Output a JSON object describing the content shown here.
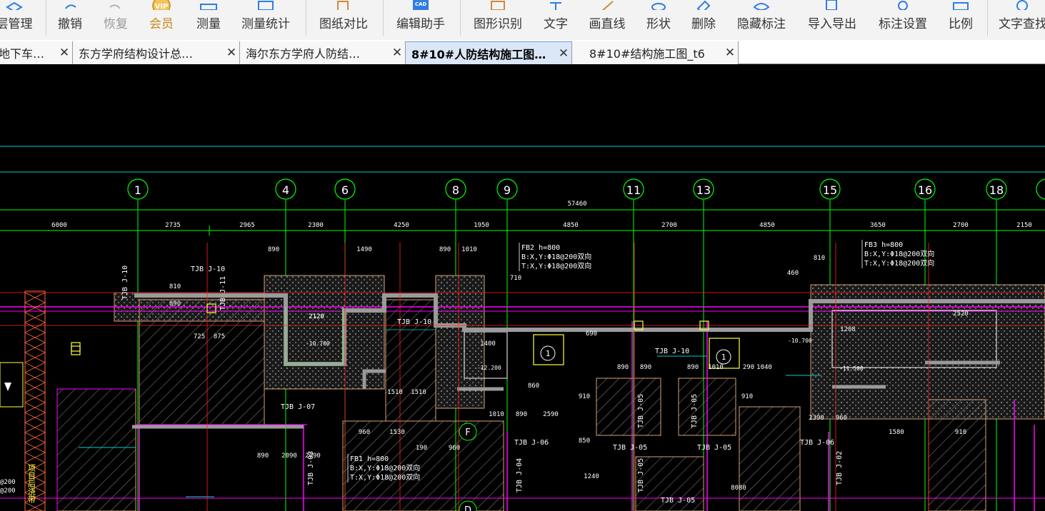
{
  "toolbar": {
    "items": [
      {
        "label": "层管理",
        "icon": "layers-icon"
      },
      {
        "label": "撤销",
        "icon": "undo-icon"
      },
      {
        "label": "恢复",
        "icon": "redo-icon",
        "disabled": true
      },
      {
        "label": "会员",
        "icon": "vip-icon",
        "badge": "VIP"
      },
      {
        "label": "测量",
        "icon": "ruler-icon"
      },
      {
        "label": "测量统计",
        "icon": "measure-stats-icon"
      },
      {
        "label": "图纸对比",
        "icon": "compare-icon"
      },
      {
        "label": "编辑助手",
        "icon": "cad-edit-icon",
        "badge": "CAD"
      },
      {
        "label": "图形识别",
        "icon": "shape-recognize-icon"
      },
      {
        "label": "文字",
        "icon": "text-icon"
      },
      {
        "label": "画直线",
        "icon": "line-icon"
      },
      {
        "label": "形状",
        "icon": "shape-icon"
      },
      {
        "label": "删除",
        "icon": "eraser-icon"
      },
      {
        "label": "隐藏标注",
        "icon": "eye-icon"
      },
      {
        "label": "导入导出",
        "icon": "import-export-icon"
      },
      {
        "label": "标注设置",
        "icon": "settings-icon"
      },
      {
        "label": "比例",
        "icon": "scale-icon"
      },
      {
        "label": "文字查找",
        "icon": "text-search-icon"
      }
    ]
  },
  "tabs": [
    {
      "label": "地下车…",
      "active": false
    },
    {
      "label": "东方学府结构设计总…",
      "active": false
    },
    {
      "label": "海尔东方学府人防结…",
      "active": false
    },
    {
      "label": "8#10#人防结构施工图…",
      "active": true
    },
    {
      "label": "8#10#结构施工图_t6",
      "active": false
    }
  ],
  "drawing": {
    "colors": {
      "green": "#00ff00",
      "red": "#ff2020",
      "magenta": "#ff00ff",
      "cyan": "#00d0d0",
      "white": "#ffffff",
      "yellow": "#ffff40",
      "gray": "#9a9a9a"
    },
    "axis_labels": [
      "1",
      "4",
      "6",
      "8",
      "9",
      "11",
      "13",
      "15",
      "16",
      "18"
    ],
    "overall_dimension": "57460",
    "bay_dimensions": [
      "6000",
      "2735",
      "2965",
      "2300",
      "4250",
      "1950",
      "4850",
      "2700",
      "4850",
      "3650",
      "2700",
      "2150"
    ],
    "sub_dimensions": [
      "890",
      "1490",
      "890",
      "1010",
      "810",
      "890",
      "710",
      "460",
      "810",
      "690",
      "725",
      "875",
      "2120",
      "2120",
      "1400",
      "1208",
      "2520",
      "890",
      "890",
      "890",
      "1010",
      "290",
      "1040",
      "1010",
      "890",
      "2590",
      "2390",
      "960",
      "1580",
      "910",
      "960",
      "1530",
      "190",
      "960",
      "890",
      "2090",
      "2090",
      "1510",
      "1510",
      "860",
      "860",
      "910",
      "910",
      "850",
      "1240",
      "8080"
    ],
    "beam_labels": [
      "TJB J-10",
      "TJB J-10",
      "TJB J-11",
      "TJB J-10",
      "TJB J-10",
      "TJB J-07",
      "TJB J-03",
      "TJB J-05",
      "TJB J-05",
      "TJB J-05",
      "TJB J-05",
      "TJB J-06",
      "TJB J-06",
      "TJB J-04",
      "TJB J-05",
      "TJB J-05",
      "TJB J-02"
    ],
    "slab_notes": [
      {
        "title": "FB2 h=800",
        "line1": "B:X,Y:Φ18@200双向",
        "line2": "T:X,Y:Φ18@200双向"
      },
      {
        "title": "FB3 h=800",
        "line1": "B:X,Y:Φ18@200双向",
        "line2": "T:X,Y:Φ18@200双向"
      },
      {
        "title": "FB1 h=800",
        "line1": "B:X,Y:Φ18@200双向",
        "line2": "T:X,Y:Φ18@200双向"
      }
    ],
    "elevations": [
      "-10.700",
      "-12.200",
      "-10.700",
      "-11.500"
    ],
    "circle_markers": [
      "1",
      "1"
    ],
    "grid_markers": [
      "F",
      "D"
    ],
    "side_notes": [
      "项目后浇带",
      "@200",
      "@200"
    ]
  }
}
